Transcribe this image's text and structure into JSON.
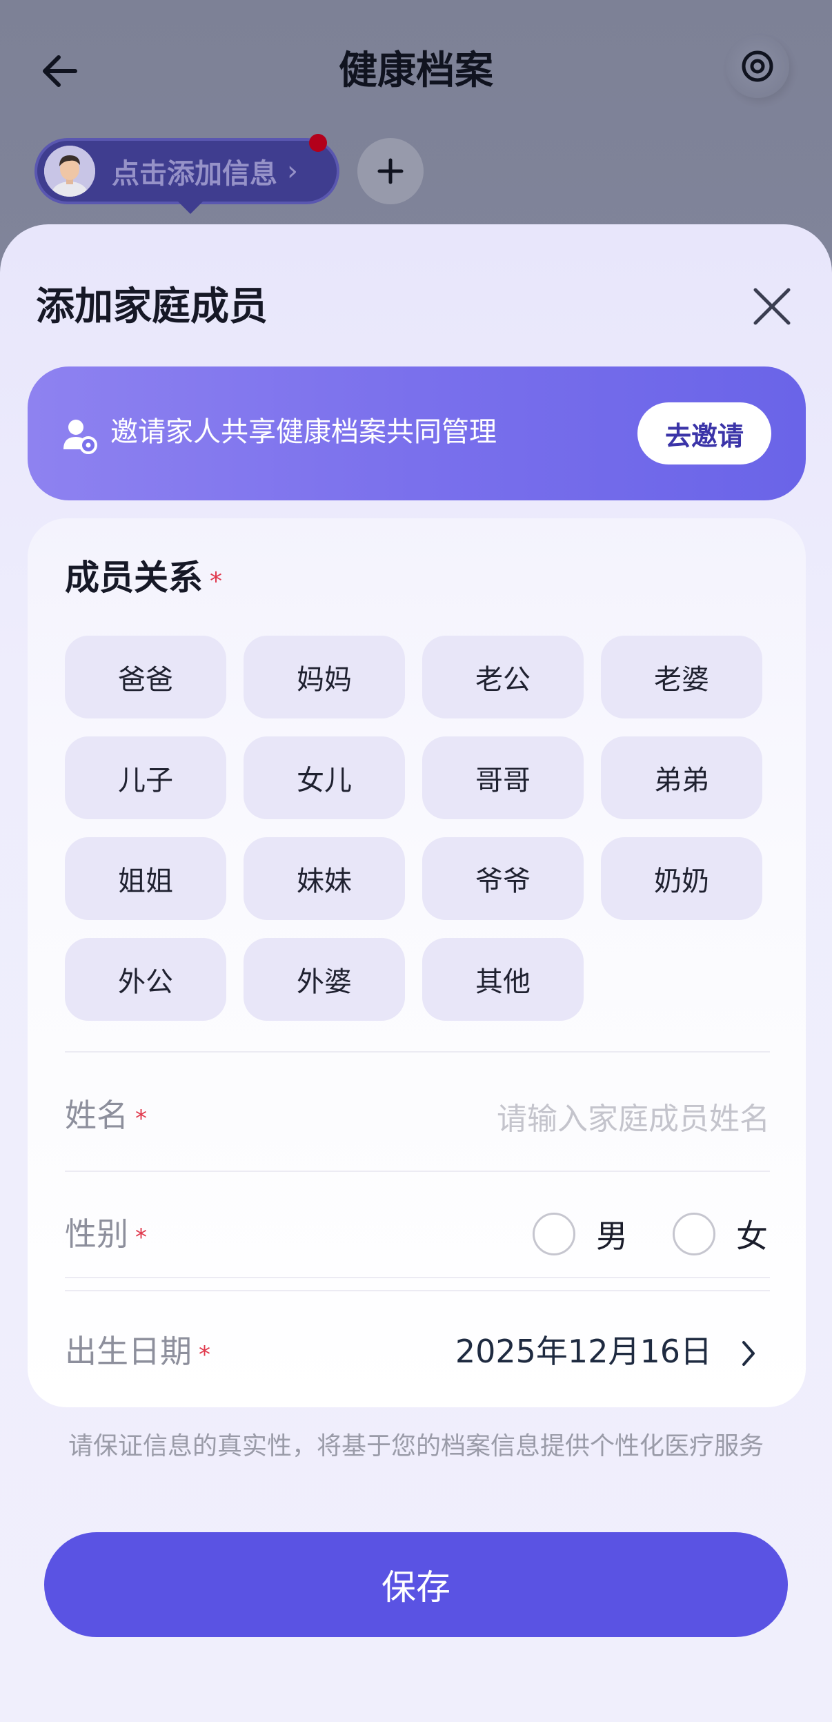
{
  "header": {
    "title": "健康档案"
  },
  "profile_chip": {
    "label": "点击添加信息",
    "chevron": "›"
  },
  "sheet": {
    "title": "添加家庭成员",
    "invite": {
      "text": "邀请家人共享健康档案共同管理",
      "button_label": "去邀请"
    },
    "relation": {
      "title": "成员关系",
      "required_mark": "*",
      "options": [
        "爸爸",
        "妈妈",
        "老公",
        "老婆",
        "儿子",
        "女儿",
        "哥哥",
        "弟弟",
        "姐姐",
        "妹妹",
        "爷爷",
        "奶奶",
        "外公",
        "外婆",
        "其他"
      ]
    },
    "name_field": {
      "label": "姓名",
      "required_mark": "*",
      "placeholder": "请输入家庭成员姓名",
      "value": ""
    },
    "gender_field": {
      "label": "性别",
      "required_mark": "*",
      "options": [
        "男",
        "女"
      ]
    },
    "birth_field": {
      "label": "出生日期",
      "required_mark": "*",
      "value": "2025年12月16日"
    },
    "notice": "请保证信息的真实性，将基于您的档案信息提供个性化医疗服务",
    "save_label": "保存"
  },
  "colors": {
    "primary": "#5a53e3",
    "banner_gradient_start": "#8e82f0",
    "banner_gradient_end": "#6a64e8",
    "required": "#e0384c",
    "notification_dot": "#b3001b"
  },
  "icons": {
    "back": "arrow-left-icon",
    "settings": "target-icon",
    "add": "plus-icon",
    "close": "close-icon",
    "invite": "user-add-icon",
    "chevron": "chevron-right-icon"
  }
}
